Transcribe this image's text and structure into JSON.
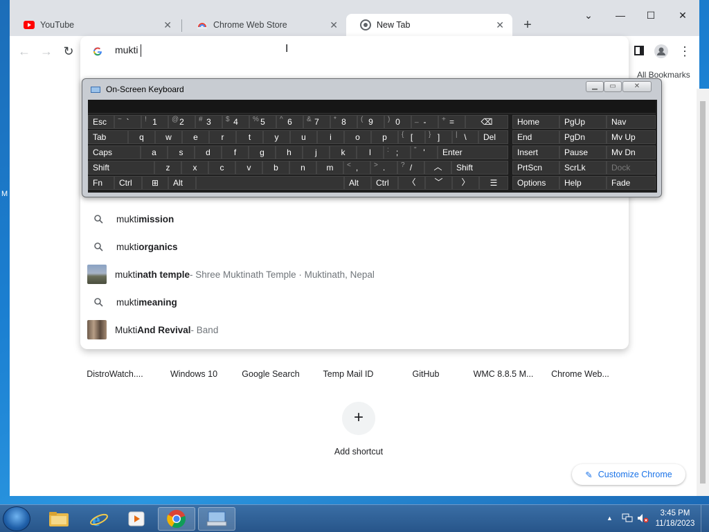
{
  "tabs": [
    {
      "title": "YouTube",
      "icon": "youtube-icon",
      "active": false
    },
    {
      "title": "Chrome Web Store",
      "icon": "chrome-web-store-icon",
      "active": false
    },
    {
      "title": "New Tab",
      "icon": "chrome-icon",
      "active": true
    }
  ],
  "bookmarks": {
    "label": "All Bookmarks"
  },
  "omnibox": {
    "value": "mukti",
    "suggestions": [
      {
        "prefix": "mukti ",
        "bold": "mission",
        "desc": "",
        "kind": "search"
      },
      {
        "prefix": "mukti ",
        "bold": "organics",
        "desc": "",
        "kind": "search"
      },
      {
        "prefix": "mukti",
        "bold": "nath temple",
        "desc": " - Shree Muktinath Temple · Muktinath, Nepal",
        "kind": "entity"
      },
      {
        "prefix": "mukti ",
        "bold": "meaning",
        "desc": "",
        "kind": "search"
      },
      {
        "prefix": "Mukti ",
        "bold": "And Revival",
        "desc": " - Band",
        "kind": "entity"
      }
    ]
  },
  "shortcuts": [
    "DistroWatch....",
    "Windows 10",
    "Google Search",
    "Temp Mail ID",
    "GitHub",
    "WMC 8.8.5 M...",
    "Chrome Web..."
  ],
  "add_shortcut": {
    "label": "Add shortcut",
    "symbol": "+"
  },
  "customize": {
    "label": "Customize Chrome"
  },
  "osk": {
    "title": "On-Screen Keyboard",
    "keys": {
      "esc": "Esc",
      "tab": "Tab",
      "caps": "Caps",
      "shift": "Shift",
      "fn": "Fn",
      "ctrl": "Ctrl",
      "alt": "Alt",
      "del": "Del",
      "enter": "Enter",
      "shift_r": "Shift",
      "alt_r": "Alt",
      "ctrl_r": "Ctrl",
      "home": "Home",
      "pgup": "PgUp",
      "nav": "Nav",
      "end": "End",
      "pgdn": "PgDn",
      "mvup": "Mv Up",
      "insert": "Insert",
      "pause": "Pause",
      "mvdn": "Mv Dn",
      "prtscn": "PrtScn",
      "scrlk": "ScrLk",
      "dock": "Dock",
      "options": "Options",
      "help": "Help",
      "fade": "Fade",
      "row1": [
        [
          "~",
          "`"
        ],
        [
          "!",
          "1"
        ],
        [
          "@",
          "2"
        ],
        [
          "#",
          "3"
        ],
        [
          "$",
          "4"
        ],
        [
          "%",
          "5"
        ],
        [
          "&",
          "6"
        ],
        [
          "&",
          "7"
        ],
        [
          "*",
          "8"
        ],
        [
          "(",
          "9"
        ],
        [
          ")",
          "0"
        ],
        [
          "_",
          "-"
        ],
        [
          "+",
          "="
        ]
      ],
      "row2": [
        "q",
        "w",
        "e",
        "r",
        "t",
        "y",
        "u",
        "i",
        "o",
        "p"
      ],
      "row2_sym": [
        [
          "{",
          "["
        ],
        [
          "}",
          "]"
        ],
        [
          "|",
          "\\"
        ]
      ],
      "row3": [
        "a",
        "s",
        "d",
        "f",
        "g",
        "h",
        "j",
        "k",
        "l"
      ],
      "row3_sym": [
        [
          ":",
          ";"
        ],
        [
          "\"",
          "'"
        ]
      ],
      "row4": [
        "z",
        "x",
        "c",
        "v",
        "b",
        "n",
        "m"
      ],
      "row4_sym": [
        [
          "<",
          ","
        ],
        [
          ">",
          "."
        ],
        [
          "?",
          "/"
        ]
      ]
    }
  },
  "taskbar": {
    "time": "3:45 PM",
    "date": "11/18/2023"
  },
  "desktop_edge_char": "M"
}
